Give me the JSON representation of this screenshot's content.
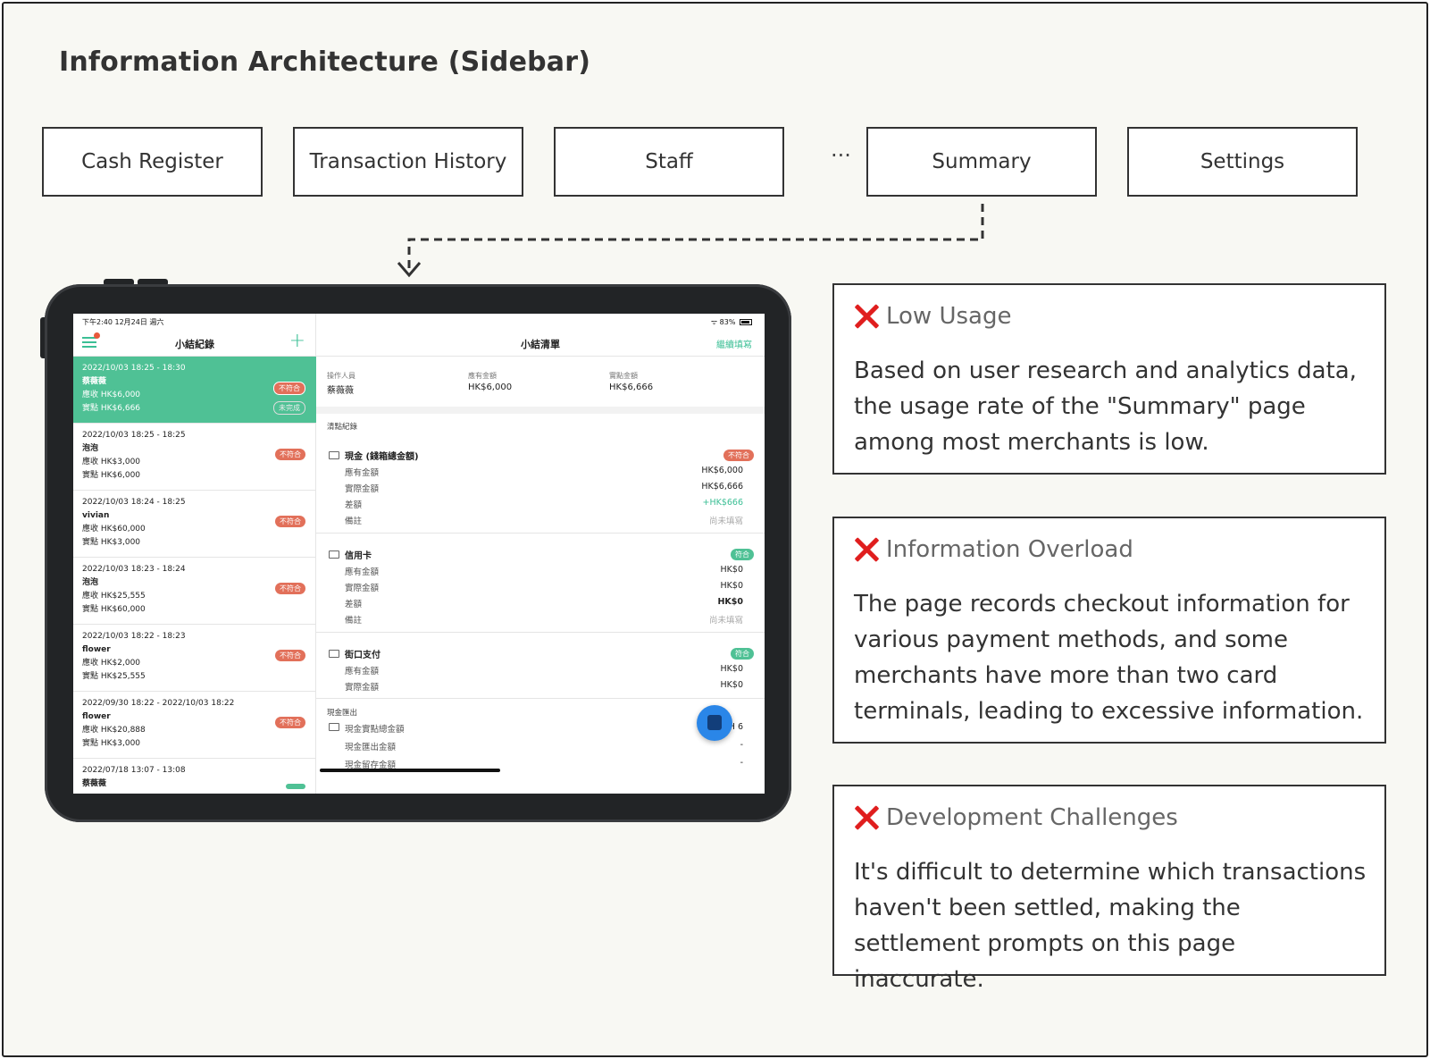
{
  "page": {
    "title": "Information Architecture (Sidebar)"
  },
  "nav": {
    "items": [
      {
        "label": "Cash Register"
      },
      {
        "label": "Transaction History"
      },
      {
        "label": "Staff"
      },
      {
        "label": "Summary"
      },
      {
        "label": "Settings"
      }
    ],
    "ellipsis": "···"
  },
  "tablet": {
    "status": {
      "time": "下午2:40  12月24日 週六",
      "battery": "83%"
    },
    "left_pane": {
      "title": "小結紀錄",
      "records": [
        {
          "time": "2022/10/03 18:25 - 18:30",
          "name": "蔡薇薇",
          "due": "應收 HK$6,000",
          "actual": "實點 HK$6,666",
          "badge": "不符合",
          "badge2": "未完成"
        },
        {
          "time": "2022/10/03 18:25 - 18:25",
          "name": "泡泡",
          "due": "應收 HK$3,000",
          "actual": "實點 HK$6,000",
          "badge": "不符合"
        },
        {
          "time": "2022/10/03 18:24 - 18:25",
          "name": "vivian",
          "due": "應收 HK$60,000",
          "actual": "實點 HK$3,000",
          "badge": "不符合"
        },
        {
          "time": "2022/10/03 18:23 - 18:24",
          "name": "泡泡",
          "due": "應收 HK$25,555",
          "actual": "實點 HK$60,000",
          "badge": "不符合"
        },
        {
          "time": "2022/10/03 18:22 - 18:23",
          "name": "flower",
          "due": "應收 HK$2,000",
          "actual": "實點 HK$25,555",
          "badge": "不符合"
        },
        {
          "time": "2022/09/30 18:22 - 2022/10/03 18:22",
          "name": "flower",
          "due": "應收 HK$20,888",
          "actual": "實點 HK$3,000",
          "badge": "不符合"
        },
        {
          "time": "2022/07/18 13:07 - 13:08",
          "name": "蔡薇薇",
          "due": "",
          "actual": "",
          "badge": ""
        }
      ]
    },
    "right_pane": {
      "title": "小結清單",
      "action": "繼續填寫",
      "summary": [
        {
          "label": "操作人員",
          "value": "蔡薇薇"
        },
        {
          "label": "應有金額",
          "value": "HK$6,000"
        },
        {
          "label": "實點金額",
          "value": "HK$6,666"
        }
      ],
      "section_label": "清點紀錄",
      "groups": [
        {
          "title": "現金 (錢箱總金額)",
          "badge": "不符合",
          "rows": [
            {
              "k": "應有金額",
              "v": "HK$6,000"
            },
            {
              "k": "實際金額",
              "v": "HK$6,666"
            },
            {
              "k": "差額",
              "v": "+HK$666"
            },
            {
              "k": "備註",
              "v": "尚未填寫"
            }
          ]
        },
        {
          "title": "信用卡",
          "badge": "符合",
          "rows": [
            {
              "k": "應有金額",
              "v": "HK$0"
            },
            {
              "k": "實際金額",
              "v": "HK$0"
            },
            {
              "k": "差額",
              "v": "HK$0"
            },
            {
              "k": "備註",
              "v": "尚未填寫"
            }
          ]
        },
        {
          "title": "街口支付",
          "badge": "符合",
          "rows": [
            {
              "k": "應有金額",
              "v": "HK$0"
            },
            {
              "k": "實際金額",
              "v": "HK$0"
            }
          ]
        }
      ],
      "cash_out": {
        "label": "現金匯出",
        "rows": [
          {
            "k": "現金實點總金額",
            "v": "H  6"
          },
          {
            "k": "現金匯出金額",
            "v": "-"
          },
          {
            "k": "現金留存金額",
            "v": "-"
          }
        ]
      }
    }
  },
  "issues": [
    {
      "title": "Low Usage",
      "text": "Based on user research and analytics data, the usage rate of the \"Summary\" page among most merchants is low."
    },
    {
      "title": "Information Overload",
      "text": "The page records checkout information for various payment methods, and some merchants have more than two card terminals, leading to excessive information."
    },
    {
      "title": "Development Challenges",
      "text": "It's difficult to determine which transactions haven't been settled, making the settlement prompts on this page inaccurate."
    }
  ],
  "colors": {
    "accent": "#4fc195",
    "error": "#e01e1e",
    "badge_red": "#e2705a"
  }
}
